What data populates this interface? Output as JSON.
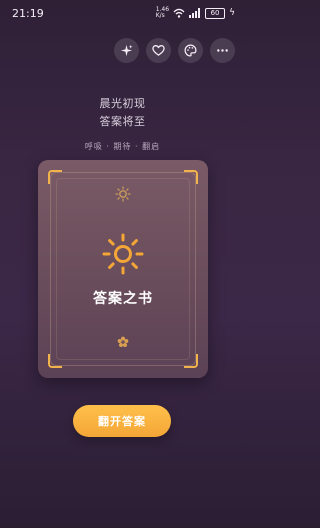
{
  "status": {
    "time": "21:19",
    "network": "1.46\nK/s",
    "battery": "60"
  },
  "header": {
    "line1": "晨光初现",
    "line2": "答案将至",
    "steps": "呼吸 · 期待 · 翻启"
  },
  "card": {
    "title": "答案之书"
  },
  "actions": {
    "open_label": "翻开答案"
  },
  "icons": {
    "sparkle": "sparkle-icon",
    "heart": "heart-icon",
    "palette": "palette-icon",
    "more": "more-icon"
  },
  "colors": {
    "accent": "#f4a637",
    "card": "#6b4e5c"
  }
}
